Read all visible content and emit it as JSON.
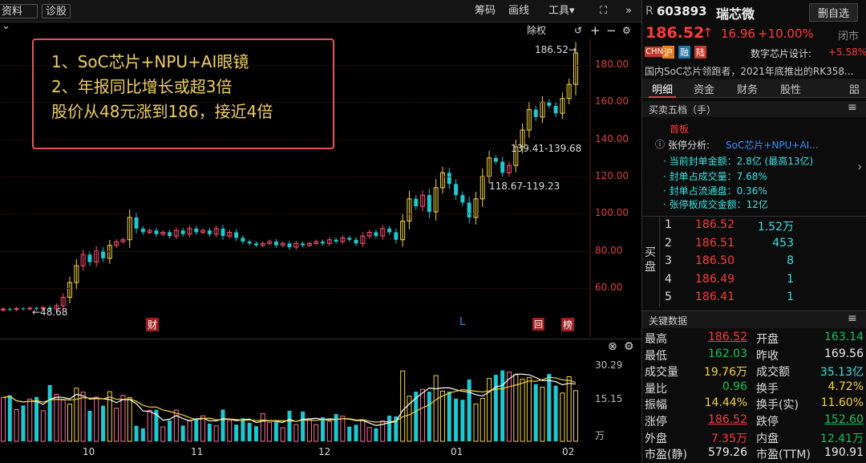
{
  "toolbar": {
    "left_tab": "资料",
    "left_tab_arrow": "⌄",
    "diagnose": "诊股",
    "chips": "筹码",
    "draw": "画线",
    "tools": "工具▾",
    "expand": "⛶",
    "collapse": "«",
    "more": "»",
    "adjust": "除权",
    "undo": "↺",
    "add": "+",
    "minus": "−",
    "settings": "⚙"
  },
  "annotation": {
    "line1": "1、SoC芯片+NPU+AI眼镜",
    "line2": "2、年报同比增长或超3倍",
    "line3": "股价从48元涨到186，接近4倍"
  },
  "chart_data": {
    "type": "candlestick",
    "ylim": [
      40,
      190
    ],
    "y_ticks": [
      "180.00",
      "160.00",
      "140.00",
      "120.00",
      "100.00",
      "80.00",
      "60.00"
    ],
    "markers": {
      "high": "186.52→",
      "low": "←48.68",
      "mid1": "139.41-139.68",
      "mid2": "118.67-119.23"
    },
    "events": {
      "fin": "财",
      "l": "L",
      "hui": "回",
      "bang": "榜"
    },
    "closes": [
      48.7,
      48.5,
      49.0,
      48.8,
      49.2,
      48.9,
      49.5,
      48.7,
      50.5,
      55.0,
      63.0,
      72.0,
      78.0,
      74.0,
      80.0,
      76.0,
      83.0,
      85.0,
      86.0,
      98.0,
      92.0,
      90.0,
      91.0,
      89.0,
      90.0,
      88.0,
      91.0,
      89.0,
      92.0,
      90.0,
      91.0,
      89.0,
      92.0,
      88.0,
      90.0,
      87.0,
      85.0,
      84.0,
      83.0,
      84.0,
      85.0,
      83.0,
      84.0,
      82.0,
      84.0,
      83.0,
      84.0,
      85.0,
      84.0,
      86.0,
      85.0,
      87.0,
      86.0,
      84.0,
      88.0,
      90.0,
      88.0,
      92.0,
      90.0,
      86.0,
      96.0,
      108.0,
      104.0,
      110.0,
      101.0,
      114.0,
      122.0,
      116.0,
      110.0,
      106.0,
      98.0,
      108.0,
      120.0,
      130.0,
      128.0,
      122.0,
      126.0,
      136.0,
      145.0,
      156.0,
      152.0,
      160.0,
      158.0,
      154.0,
      162.0,
      169.6,
      186.5
    ],
    "volume": {
      "ylabels": [
        "30.29",
        "15.15",
        "万"
      ],
      "x_labels": [
        "10",
        "11",
        "12",
        "01",
        "02"
      ]
    }
  },
  "quote": {
    "prefix": "R",
    "code": "603893",
    "name": "瑞芯微",
    "remove_btn": "删自选",
    "price": "186.52",
    "arrow": "↑",
    "change": "16.96",
    "pct": "+10.00%",
    "status": "闭市",
    "tags": [
      "CHN",
      "沪",
      "融",
      "陆"
    ],
    "sector": "数字芯片设计:",
    "sector_pct": "+5.58%",
    "news": "国内SoC芯片领跑者，2021年底推出的RK358..."
  },
  "tabs": [
    "明细",
    "资金",
    "财务",
    "股性",
    "㗊"
  ],
  "orderbook": {
    "title": "买卖五档（手）",
    "menu": "≡",
    "board": "首板",
    "analysis_label": "张停分析:",
    "analysis_text": "SoC芯片+NPU+AI...",
    "info_icon": "ⓘ",
    "nav": "›",
    "details": [
      "· 当前封单金额：2.8亿 (最高13亿)",
      "· 封单占成交量：7.68%",
      "· 封单占流通盘：0.36%",
      "· 张停板成交金额：12亿"
    ],
    "buy_label": "买盘",
    "bids": [
      {
        "n": "1",
        "p": "186.52",
        "v": "1.52万"
      },
      {
        "n": "2",
        "p": "186.51",
        "v": "453"
      },
      {
        "n": "3",
        "p": "186.50",
        "v": "8"
      },
      {
        "n": "4",
        "p": "186.49",
        "v": "1"
      },
      {
        "n": "5",
        "p": "186.41",
        "v": "1"
      }
    ]
  },
  "keydata": {
    "title": "关键数据",
    "menu": "≡",
    "rows": [
      {
        "l1": "最高",
        "v1": "186.52",
        "c1": "red",
        "l2": "开盘",
        "v2": "163.14",
        "c2": "green"
      },
      {
        "l1": "最低",
        "v1": "162.03",
        "c1": "green",
        "l2": "昨收",
        "v2": "169.56",
        "c2": "white"
      },
      {
        "l1": "成交量",
        "v1": "19.76万",
        "c1": "yellow",
        "l2": "成交额",
        "v2": "35.13亿",
        "c2": "cyan"
      },
      {
        "l1": "量比",
        "v1": "0.96",
        "c1": "green",
        "l2": "换手",
        "v2": "4.72%",
        "c2": "yellow"
      },
      {
        "l1": "振幅",
        "v1": "14.44%",
        "c1": "yellow",
        "l2": "换手(实)",
        "v2": "11.60%",
        "c2": "yellow"
      },
      {
        "l1": "涨停",
        "v1": "186.52",
        "c1": "red",
        "l2": "跌停",
        "v2": "152.60",
        "c2": "green"
      },
      {
        "l1": "外盘",
        "v1": "7.35万",
        "c1": "red",
        "l2": "内盘",
        "v2": "12.41万",
        "c2": "green"
      },
      {
        "l1": "市盈(静)",
        "v1": "579.26",
        "c1": "white",
        "l2": "市盈(TTM)",
        "v2": "190.91",
        "c2": "white"
      }
    ]
  }
}
